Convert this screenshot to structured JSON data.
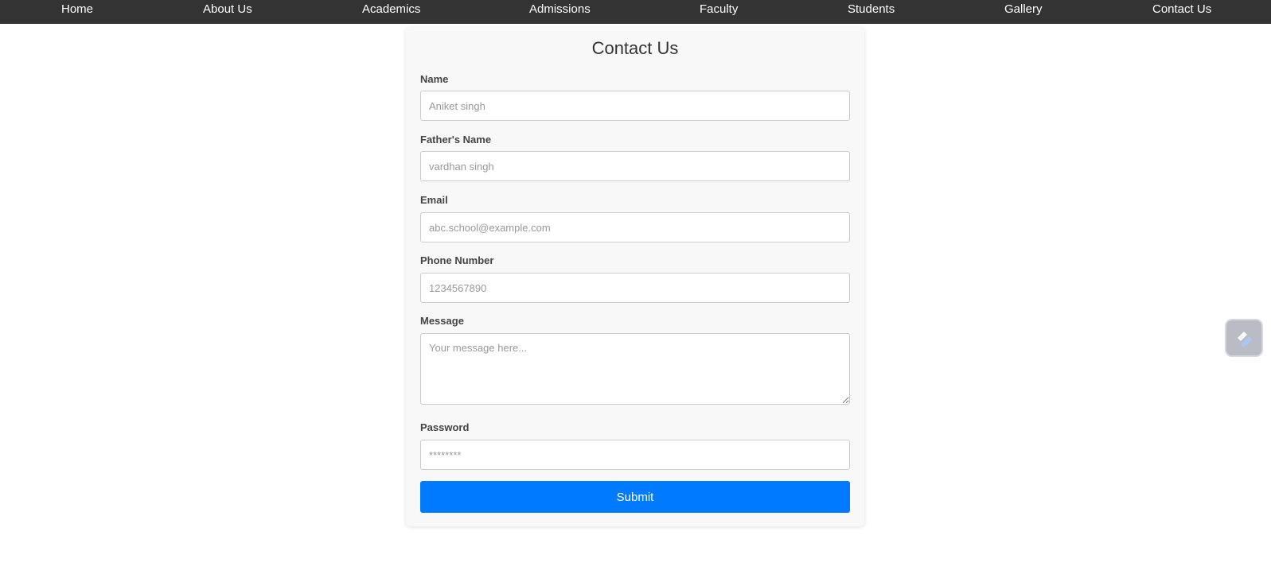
{
  "nav": {
    "items": [
      {
        "label": "Home"
      },
      {
        "label": "About Us"
      },
      {
        "label": "Academics"
      },
      {
        "label": "Admissions"
      },
      {
        "label": "Faculty"
      },
      {
        "label": "Students"
      },
      {
        "label": "Gallery"
      },
      {
        "label": "Contact Us"
      }
    ]
  },
  "form": {
    "title": "Contact Us",
    "fields": {
      "name": {
        "label": "Name",
        "placeholder": "Aniket singh",
        "value": ""
      },
      "father_name": {
        "label": "Father's Name",
        "placeholder": "vardhan singh",
        "value": ""
      },
      "email": {
        "label": "Email",
        "placeholder": "abc.school@example.com",
        "value": ""
      },
      "phone": {
        "label": "Phone Number",
        "placeholder": "1234567890",
        "value": ""
      },
      "message": {
        "label": "Message",
        "placeholder": "Your message here...",
        "value": ""
      },
      "password": {
        "label": "Password",
        "placeholder": "********",
        "value": ""
      }
    },
    "submit_label": "Submit"
  },
  "widget": {
    "icon": "pen-icon"
  },
  "colors": {
    "navbar_bg": "#333333",
    "nav_text": "#ffffff",
    "card_bg": "#f8f8f8",
    "submit_bg": "#007bff",
    "submit_text": "#ffffff"
  }
}
